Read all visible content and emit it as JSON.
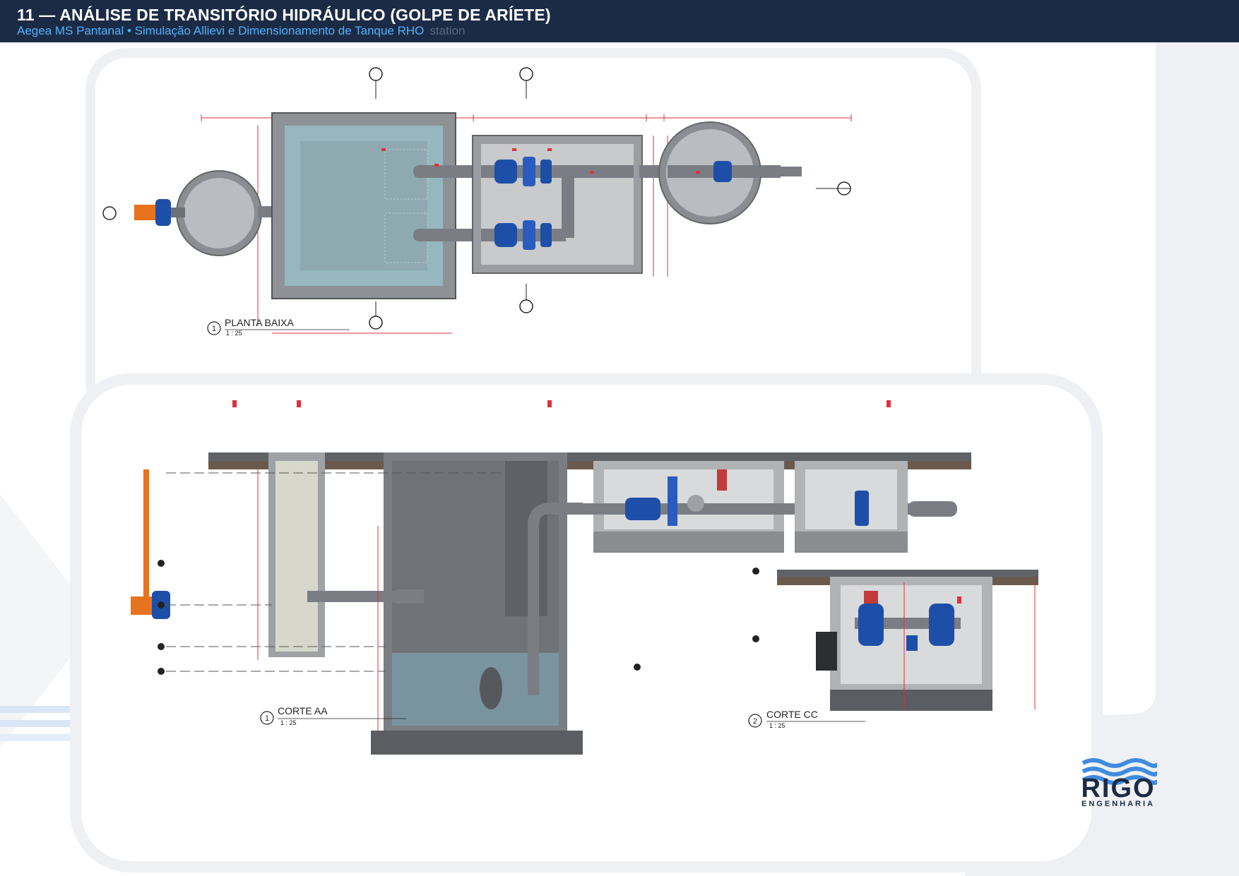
{
  "header": {
    "title": "11 — ANÁLISE DE TRANSITÓRIO HIDRÁULICO (GOLPE DE ARÍETE)",
    "subtitle": "Aegea MS Pantanal • Simulação Allievi e Dimensionamento de Tanque RHO",
    "ghost_text": "station"
  },
  "plan": {
    "title": "PLANTA BAIXA",
    "scale": "1 : 25",
    "number": "1"
  },
  "section_aa": {
    "title": "CORTE AA",
    "scale": "1 : 25",
    "number": "1"
  },
  "section_cc": {
    "title": "CORTE CC",
    "scale": "1 : 25",
    "number": "2"
  },
  "logo": {
    "name": "RIGO",
    "tagline": "ENGENHARIA"
  },
  "colors": {
    "header_bg": "#1b2b45",
    "subtitle": "#4fb3ff",
    "accent_red": "#e0303a",
    "valve_blue": "#1e4fa8",
    "pipe_orange": "#e8731e",
    "logo_blue": "#3f8be0"
  }
}
